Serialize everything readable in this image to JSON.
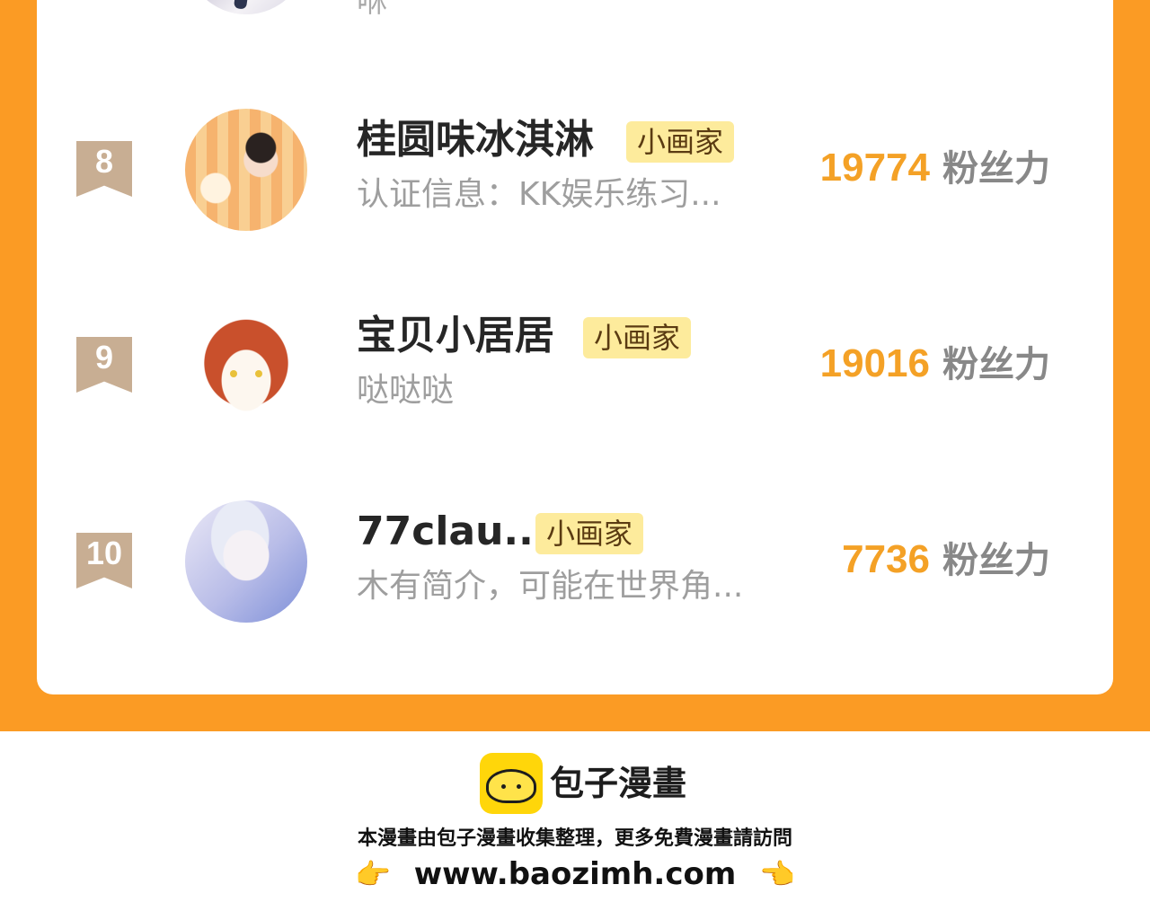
{
  "previous_row": {
    "desc": "咻"
  },
  "rows": [
    {
      "rank": "8",
      "name": "桂圆味冰淇淋",
      "badge": "小画家",
      "desc": "认证信息：KK娱乐练习...",
      "fans": "19774",
      "fans_label": "粉丝力"
    },
    {
      "rank": "9",
      "name": "宝贝小居居",
      "badge": "小画家",
      "desc": "哒哒哒",
      "fans": "19016",
      "fans_label": "粉丝力"
    },
    {
      "rank": "10",
      "name": "77clau...",
      "badge": "小画家",
      "desc": "木有简介，可能在世界角...",
      "fans": "7736",
      "fans_label": "粉丝力"
    }
  ],
  "footer": {
    "brand": "包子漫畫",
    "notice": "本漫畫由包子漫畫收集整理，更多免費漫畫請訪問",
    "url": "www.baozimh.com",
    "left_hand": "👉",
    "right_hand": "👈"
  },
  "colors": {
    "orange": "#fb9b24",
    "fans_number": "#f4a126",
    "badge_bg": "#fdeb9c",
    "rank_bg": "#c8ae93"
  }
}
